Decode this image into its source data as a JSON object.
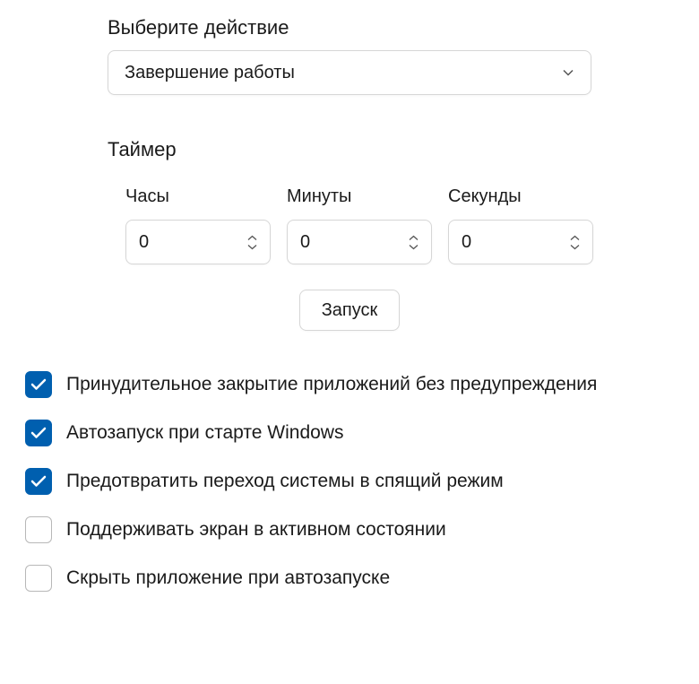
{
  "action": {
    "label": "Выберите действие",
    "selected": "Завершение работы"
  },
  "timer": {
    "label": "Таймер",
    "hours_label": "Часы",
    "minutes_label": "Минуты",
    "seconds_label": "Секунды",
    "hours": "0",
    "minutes": "0",
    "seconds": "0"
  },
  "start_button": "Запуск",
  "options": {
    "force_close": {
      "label": "Принудительное закрытие приложений без предупреждения",
      "checked": true
    },
    "autostart": {
      "label": "Автозапуск при старте Windows",
      "checked": true
    },
    "prevent_sleep": {
      "label": "Предотвратить переход системы в спящий режим",
      "checked": true
    },
    "keep_screen": {
      "label": "Поддерживать экран в активном состоянии",
      "checked": false
    },
    "hide_on_autostart": {
      "label": "Скрыть приложение при автозапуске",
      "checked": false
    }
  }
}
